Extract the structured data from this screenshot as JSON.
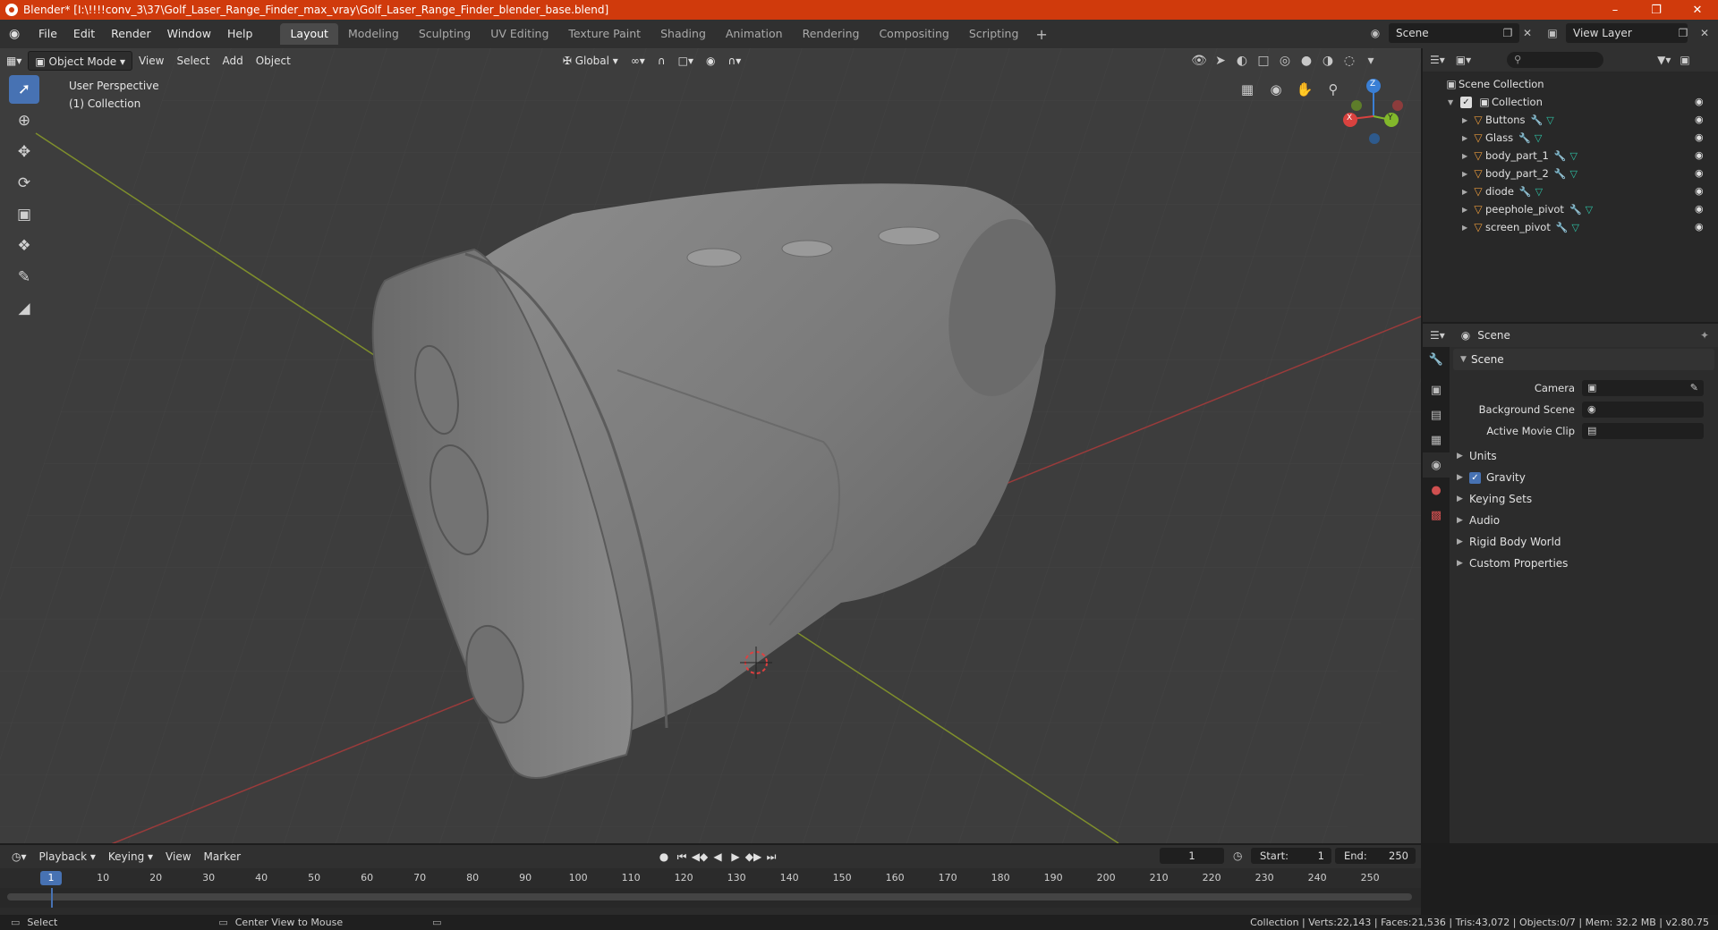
{
  "window": {
    "title": "Blender* [I:\\!!!!conv_3\\37\\Golf_Laser_Range_Finder_max_vray\\Golf_Laser_Range_Finder_blender_base.blend]"
  },
  "menu": {
    "file": "File",
    "edit": "Edit",
    "render": "Render",
    "window": "Window",
    "help": "Help"
  },
  "workspaces": [
    "Layout",
    "Modeling",
    "Sculpting",
    "UV Editing",
    "Texture Paint",
    "Shading",
    "Animation",
    "Rendering",
    "Compositing",
    "Scripting"
  ],
  "scene_selector": {
    "scene": "Scene",
    "view_layer": "View Layer"
  },
  "viewport": {
    "mode": "Object Mode",
    "menus": {
      "view": "View",
      "select": "Select",
      "add": "Add",
      "object": "Object"
    },
    "orientation": "Global",
    "info_line1": "User Perspective",
    "info_line2": "(1) Collection",
    "gizmo": {
      "x": "X",
      "y": "Y",
      "z": "Z"
    }
  },
  "outliner": {
    "root": "Scene Collection",
    "collection": "Collection",
    "objects": [
      "Buttons",
      "Glass",
      "body_part_1",
      "body_part_2",
      "diode",
      "peephole_pivot",
      "screen_pivot"
    ]
  },
  "properties": {
    "context": "Scene",
    "panel_title": "Scene",
    "fields": {
      "camera": "Camera",
      "background_scene": "Background Scene",
      "active_movie_clip": "Active Movie Clip"
    },
    "subpanels": {
      "units": "Units",
      "gravity": "Gravity",
      "keying_sets": "Keying Sets",
      "audio": "Audio",
      "rigid_body_world": "Rigid Body World",
      "custom_properties": "Custom Properties"
    }
  },
  "timeline": {
    "menus": {
      "playback": "Playback",
      "keying": "Keying",
      "view": "View",
      "marker": "Marker"
    },
    "current_frame": "1",
    "start_label": "Start:",
    "start": "1",
    "end_label": "End:",
    "end": "250",
    "ruler": [
      "1",
      "10",
      "20",
      "30",
      "40",
      "50",
      "60",
      "70",
      "80",
      "90",
      "100",
      "110",
      "120",
      "130",
      "140",
      "150",
      "160",
      "170",
      "180",
      "190",
      "200",
      "210",
      "220",
      "230",
      "240",
      "250"
    ]
  },
  "statusbar": {
    "select": "Select",
    "center_view": "Center View to Mouse",
    "stats": "Collection | Verts:22,143 | Faces:21,536 | Tris:43,072 | Objects:0/7 | Mem: 32.2 MB | v2.80.75"
  },
  "colors": {
    "accent": "#4772b3",
    "titlebar": "#d03a0c",
    "object_icon": "#e89a3c",
    "mesh_icon": "#2ec3a6"
  }
}
